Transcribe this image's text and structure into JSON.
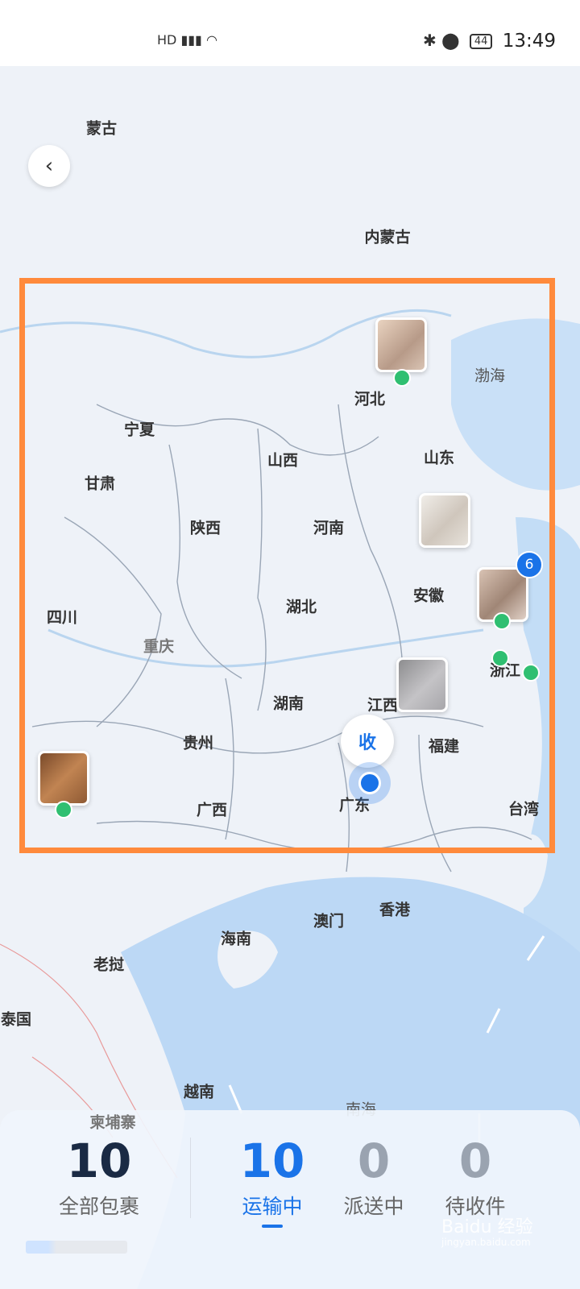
{
  "status_bar": {
    "signal_text": "HD 5G",
    "battery": "44",
    "time": "13:49"
  },
  "map": {
    "places": [
      {
        "name": "蒙古"
      },
      {
        "name": "内蒙古"
      },
      {
        "name": "渤海"
      },
      {
        "name": "河北"
      },
      {
        "name": "宁夏"
      },
      {
        "name": "山西"
      },
      {
        "name": "山东"
      },
      {
        "name": "甘肃"
      },
      {
        "name": "陕西"
      },
      {
        "name": "河南"
      },
      {
        "name": "安徽"
      },
      {
        "name": "四川"
      },
      {
        "name": "湖北"
      },
      {
        "name": "重庆"
      },
      {
        "name": "湖南"
      },
      {
        "name": "江西"
      },
      {
        "name": "浙江"
      },
      {
        "name": "贵州"
      },
      {
        "name": "福建"
      },
      {
        "name": "广西"
      },
      {
        "name": "广东"
      },
      {
        "name": "台湾"
      },
      {
        "name": "澳门"
      },
      {
        "name": "香港"
      },
      {
        "name": "海南"
      },
      {
        "name": "老挝"
      },
      {
        "name": "泰国"
      },
      {
        "name": "越南"
      },
      {
        "name": "南海"
      },
      {
        "name": "柬埔寨"
      }
    ],
    "cluster_badge": "6",
    "receive_label": "收"
  },
  "summary": {
    "stats": [
      {
        "value": "10",
        "label": "全部包裹"
      },
      {
        "value": "10",
        "label": "运输中"
      },
      {
        "value": "0",
        "label": "派送中"
      },
      {
        "value": "0",
        "label": "待收件"
      }
    ]
  },
  "watermark": {
    "brand": "Baidu 经验",
    "sub": "jingyan.baidu.com"
  },
  "colors": {
    "accent": "#1a73e8",
    "highlight": "#ff8a3c",
    "marker": "#2fbf71",
    "sea": "#bcd8f5",
    "land": "#eef2f8"
  }
}
